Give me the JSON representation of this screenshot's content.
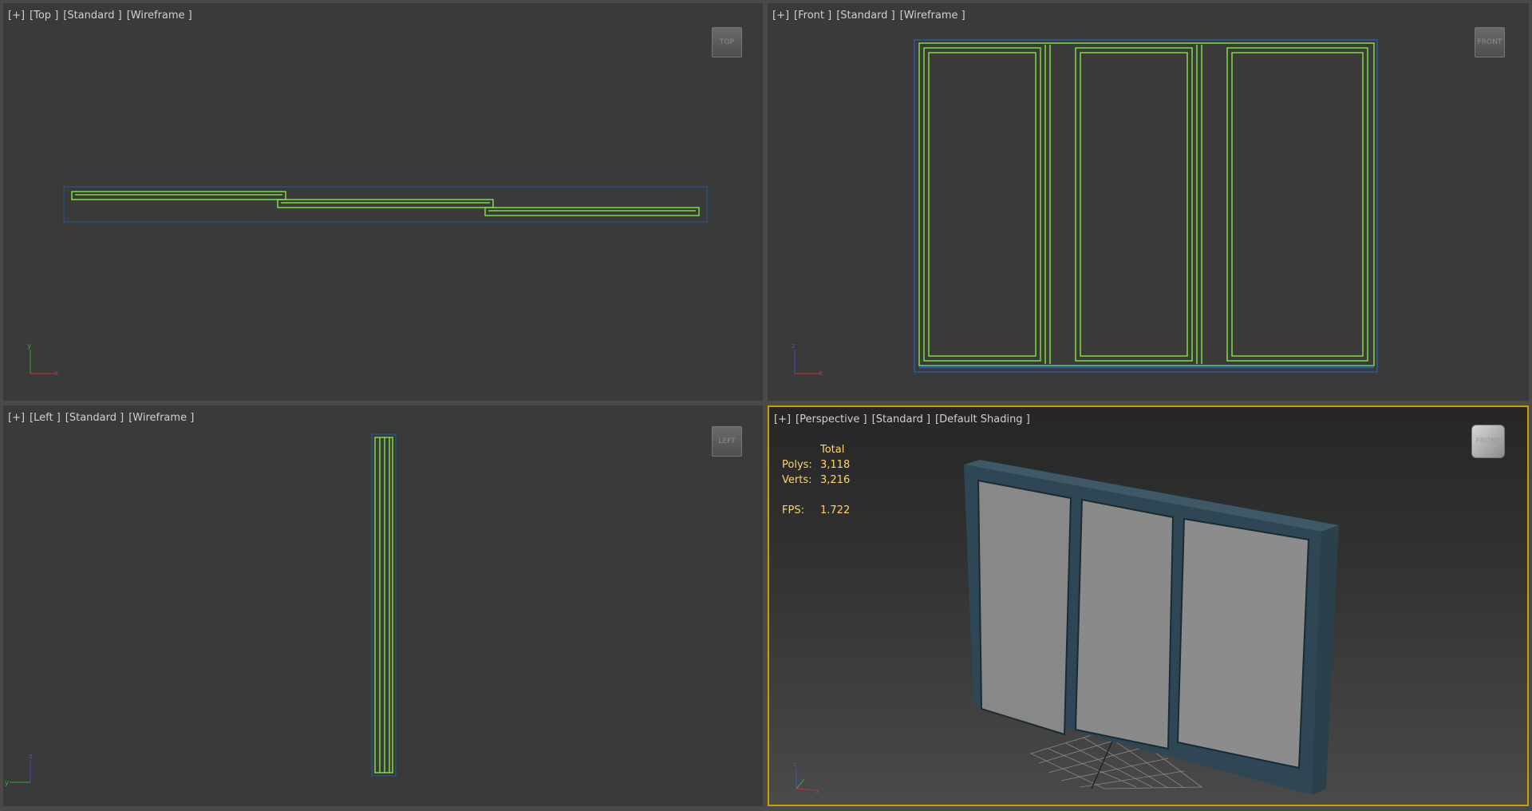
{
  "viewports": {
    "top": {
      "labels": [
        "[+]",
        "[Top ]",
        "[Standard ]",
        "[Wireframe ]"
      ],
      "cube": "TOP"
    },
    "front": {
      "labels": [
        "[+]",
        "[Front ]",
        "[Standard ]",
        "[Wireframe ]"
      ],
      "cube": "FRONT"
    },
    "left": {
      "labels": [
        "[+]",
        "[Left ]",
        "[Standard ]",
        "[Wireframe ]"
      ],
      "cube": "LEFT"
    },
    "perspective": {
      "labels": [
        "[+]",
        "[Perspective ]",
        "[Standard ]",
        "[Default Shading ]"
      ],
      "cube": "FRONT"
    }
  },
  "stats": {
    "header": "Total",
    "polys_label": "Polys:",
    "polys": "3,118",
    "verts_label": "Verts:",
    "verts": "3,216",
    "fps_label": "FPS:",
    "fps": "1.722"
  },
  "axes": {
    "x": "x",
    "y": "y",
    "z": "z"
  },
  "colors": {
    "wire": "#7ddc3c",
    "bbox": "#2a5a9a",
    "active_border": "#c8a000",
    "stats": "#ffd56a"
  }
}
